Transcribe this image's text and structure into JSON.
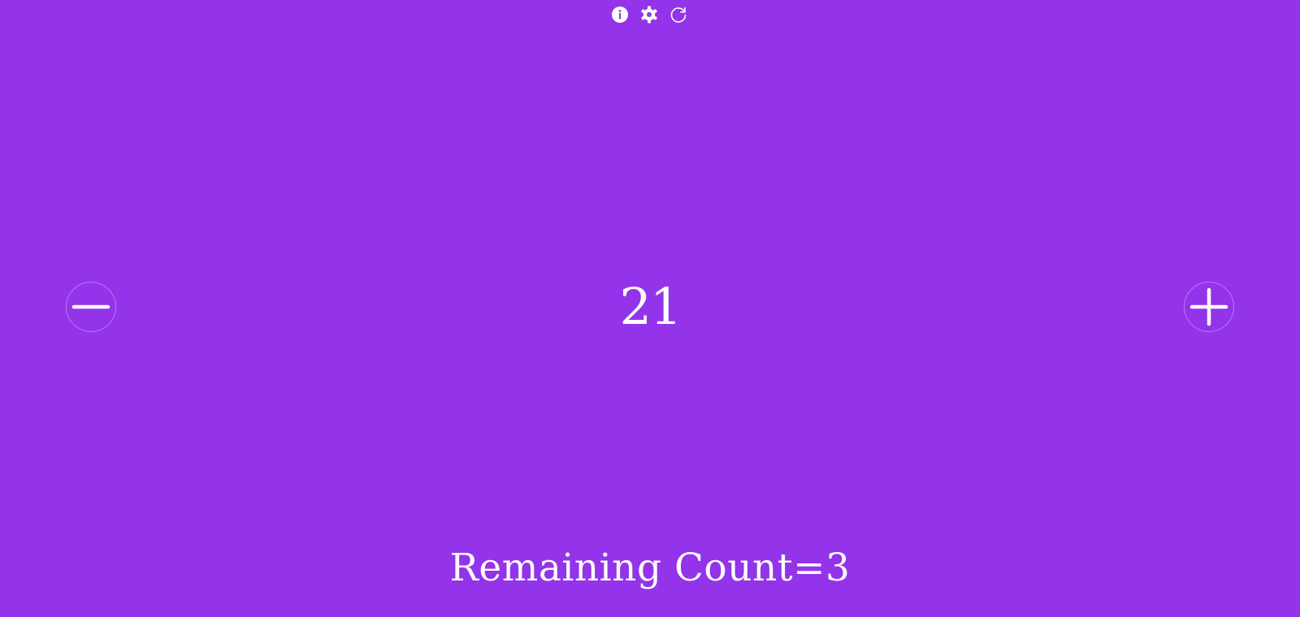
{
  "toolbar": {
    "icons": [
      "info-icon",
      "gear-icon",
      "refresh-icon"
    ]
  },
  "counter": {
    "value": "21"
  },
  "remaining": {
    "text": "Remaining Count=3"
  },
  "colors": {
    "background": "#9333ea",
    "foreground": "#ffffff"
  }
}
